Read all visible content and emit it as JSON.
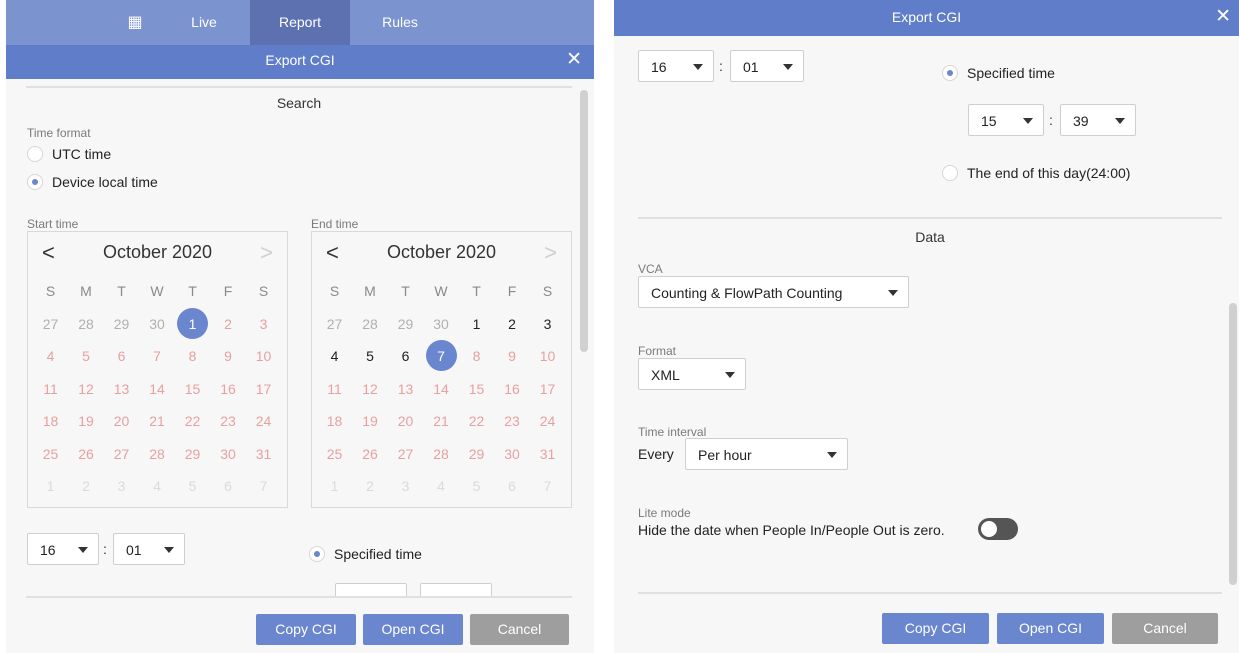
{
  "nav": {
    "grid_icon": "grid-icon",
    "items": [
      {
        "label": "Live"
      },
      {
        "label": "Report"
      },
      {
        "label": "Rules"
      }
    ],
    "active": "Report"
  },
  "dialog": {
    "title": "Export CGI",
    "close_icon": "close-icon",
    "close_glyph": "✕"
  },
  "search": {
    "title": "Search",
    "time_format_label": "Time format",
    "options": [
      {
        "label": "UTC time",
        "checked": false
      },
      {
        "label": "Device local time",
        "checked": true
      }
    ]
  },
  "start_time": {
    "label": "Start time",
    "month": "October 2020",
    "prev_glyph": "<",
    "next_glyph": ">",
    "weekdays": [
      "S",
      "M",
      "T",
      "W",
      "T",
      "F",
      "S"
    ],
    "weeks": [
      [
        "27",
        "28",
        "29",
        "30",
        "1",
        "2",
        "3"
      ],
      [
        "4",
        "5",
        "6",
        "7",
        "8",
        "9",
        "10"
      ],
      [
        "11",
        "12",
        "13",
        "14",
        "15",
        "16",
        "17"
      ],
      [
        "18",
        "19",
        "20",
        "21",
        "22",
        "23",
        "24"
      ],
      [
        "25",
        "26",
        "27",
        "28",
        "29",
        "30",
        "31"
      ],
      [
        "1",
        "2",
        "3",
        "4",
        "5",
        "6",
        "7"
      ]
    ],
    "selected_day": "1",
    "hour": "16",
    "minute": "01"
  },
  "end_time": {
    "label": "End time",
    "month": "October 2020",
    "prev_glyph": "<",
    "next_glyph": ">",
    "weekdays": [
      "S",
      "M",
      "T",
      "W",
      "T",
      "F",
      "S"
    ],
    "weeks": [
      [
        "27",
        "28",
        "29",
        "30",
        "1",
        "2",
        "3"
      ],
      [
        "4",
        "5",
        "6",
        "7",
        "8",
        "9",
        "10"
      ],
      [
        "11",
        "12",
        "13",
        "14",
        "15",
        "16",
        "17"
      ],
      [
        "18",
        "19",
        "20",
        "21",
        "22",
        "23",
        "24"
      ],
      [
        "25",
        "26",
        "27",
        "28",
        "29",
        "30",
        "31"
      ],
      [
        "1",
        "2",
        "3",
        "4",
        "5",
        "6",
        "7"
      ]
    ],
    "selected_day": "7",
    "specified_time_label": "Specified time",
    "specified_checked": true,
    "hour": "15",
    "minute": "39",
    "end_of_day_label": "The end of this day(24:00)"
  },
  "data_section": {
    "title": "Data",
    "vca_label": "VCA",
    "vca_value": "Counting & FlowPath Counting",
    "format_label": "Format",
    "format_value": "XML",
    "interval_label": "Time interval",
    "interval_prefix": "Every",
    "interval_value": "Per hour",
    "lite_label": "Lite mode",
    "lite_text": "Hide the date when People In/People Out is zero.",
    "lite_enabled": false
  },
  "buttons": {
    "copy": "Copy CGI",
    "open": "Open CGI",
    "cancel": "Cancel"
  },
  "colon": ":",
  "colors": {
    "nav_bg": "#7b93cf",
    "nav_active": "#5d71b0",
    "title_bg": "#5f7dc9",
    "accent": "#6a86cf",
    "cancel_bg": "#9e9e9e",
    "weekend_text": "#e7a0a0"
  }
}
